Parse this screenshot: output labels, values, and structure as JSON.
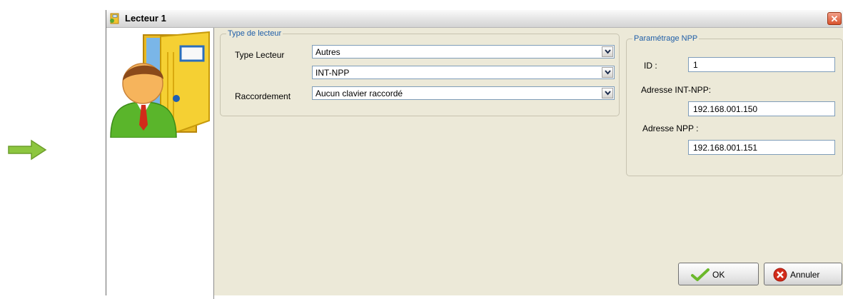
{
  "window": {
    "title": "Lecteur 1",
    "close_glyph": "✕"
  },
  "icons": {
    "arrow": "right-arrow-icon",
    "title": "door-icon",
    "avatar": "user-door-icon",
    "ok": "check-icon",
    "cancel": "cancel-icon"
  },
  "type_group": {
    "legend": "Type de lecteur",
    "type_label": "Type Lecteur",
    "type_value": "Autres",
    "model_value": "INT-NPP",
    "connection_label": "Raccordement",
    "connection_value": "Aucun clavier raccordé"
  },
  "npp_group": {
    "legend": "Paramétrage NPP",
    "id_label": "ID :",
    "id_value": "1",
    "int_npp_label": "Adresse INT-NPP:",
    "int_npp_value": "192.168.001.150",
    "npp_label": "Adresse NPP :",
    "npp_value": "192.168.001.151"
  },
  "buttons": {
    "ok": "OK",
    "cancel": "Annuler"
  },
  "colors": {
    "arrow": "#8dc63f",
    "legend": "#1f5ea8",
    "ok_check": "#6bb82b",
    "cancel_red": "#d22b1a"
  }
}
